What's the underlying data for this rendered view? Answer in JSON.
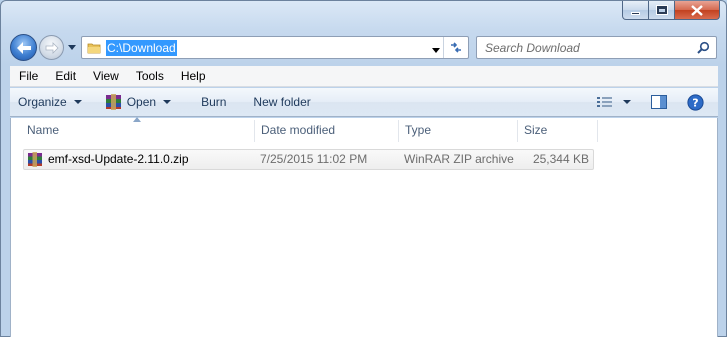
{
  "nav": {
    "address": "C:\\Download",
    "search_placeholder": "Search Download"
  },
  "menu": [
    "File",
    "Edit",
    "View",
    "Tools",
    "Help"
  ],
  "toolbar": {
    "organize": "Organize",
    "open": "Open",
    "burn": "Burn",
    "new_folder": "New folder"
  },
  "columns": {
    "name": "Name",
    "date": "Date modified",
    "type": "Type",
    "size": "Size"
  },
  "files": [
    {
      "name": "emf-xsd-Update-2.11.0.zip",
      "date": "7/25/2015 11:02 PM",
      "type": "WinRAR ZIP archive",
      "size": "25,344 KB"
    }
  ],
  "icons": {
    "back": "back-arrow-icon",
    "forward": "forward-arrow-icon",
    "folder": "folder-icon",
    "refresh": "refresh-icon",
    "search": "search-icon",
    "archive": "winrar-archive-icon",
    "views": "views-icon",
    "preview_pane": "preview-pane-icon",
    "help": "help-icon"
  },
  "colors": {
    "selection": "#3399ff",
    "frame": "#bcd2ea",
    "close_button": "#c2411f"
  }
}
